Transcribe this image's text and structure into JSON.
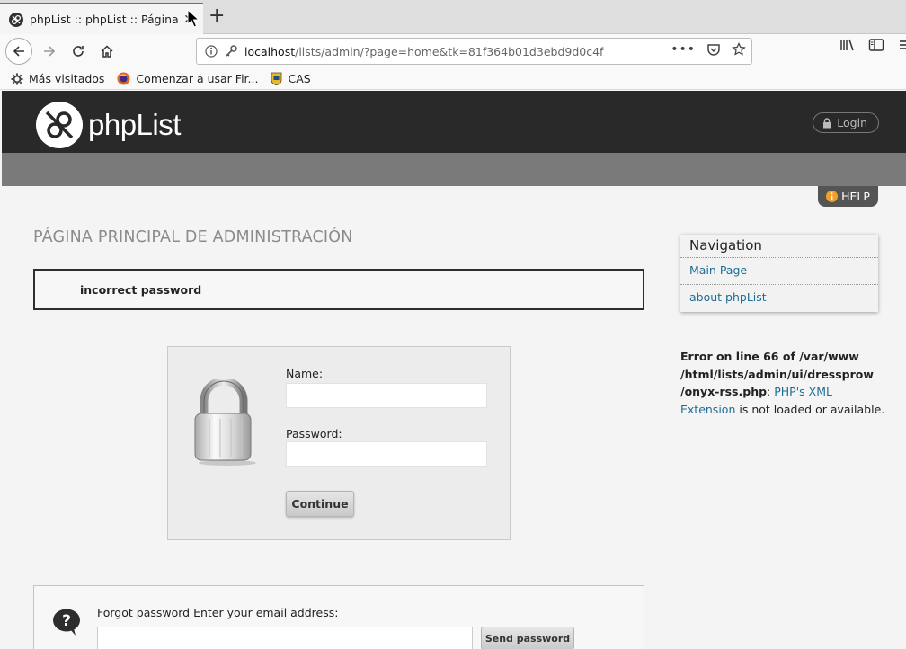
{
  "browser": {
    "tab_title": "phpList :: phpList :: Página principal de administración",
    "url_host": "localhost",
    "url_path": "/lists/admin/?page=home&tk=81f364b01d3ebd9d0c4f",
    "bookmarks": [
      {
        "label": "Más visitados",
        "icon": "gear-icon"
      },
      {
        "label": "Comenzar a usar Fir...",
        "icon": "firefox-icon"
      },
      {
        "label": "CAS",
        "icon": "shield-icon"
      }
    ]
  },
  "header": {
    "logo_text": "phpList",
    "login_label": "Login"
  },
  "help_label": "HELP",
  "main": {
    "page_title": "PÁGINA PRINCIPAL DE ADMINISTRACIÓN",
    "error_message": "incorrect password",
    "login_form": {
      "name_label": "Name:",
      "name_value": "",
      "password_label": "Password:",
      "password_value": "",
      "continue_label": "Continue"
    },
    "forgot": {
      "text": "Forgot password Enter your email address:",
      "email_value": "",
      "send_label": "Send password"
    }
  },
  "sidebar": {
    "nav_title": "Navigation",
    "nav_items": [
      {
        "label": "Main Page"
      },
      {
        "label": "about phpList"
      }
    ],
    "error_bold_1": "Error on line 66 of /var/www",
    "error_bold_2": "/html/lists/admin/ui/dressprow",
    "error_bold_3": "/onyx-rss.php",
    "error_colon": ":",
    "error_link_1": "PHP's XML",
    "error_link_2": "Extension",
    "error_tail": "is not loaded or available."
  },
  "colors": {
    "header_bg": "#292929",
    "subbar_bg": "#7a7a7a",
    "link": "#1f6d95",
    "tab_accent": "#0a84ff"
  }
}
